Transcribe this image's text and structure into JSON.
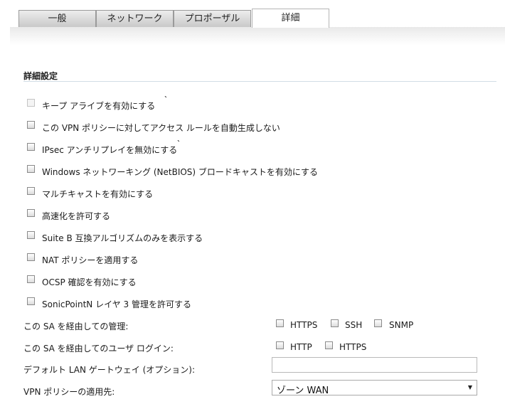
{
  "tabs": [
    {
      "label": "一般"
    },
    {
      "label": "ネットワーク"
    },
    {
      "label": "プロポーザル"
    },
    {
      "label": "詳細"
    }
  ],
  "section": {
    "title": "詳細設定"
  },
  "checkboxes": [
    {
      "label": "キープ アライブを有効にする",
      "checked": false,
      "disabled": true
    },
    {
      "label": "この VPN ポリシーに対してアクセス ルールを自動生成しない",
      "checked": false
    },
    {
      "label": "IPsec アンチリプレイを無効にする",
      "checked": false
    },
    {
      "label": "Windows ネットワーキング (NetBIOS) ブロードキャストを有効にする",
      "checked": false
    },
    {
      "label": "マルチキャストを有効にする",
      "checked": false
    },
    {
      "label": "高速化を許可する",
      "checked": false
    },
    {
      "label": "Suite B 互換アルゴリズムのみを表示する",
      "checked": false
    },
    {
      "label": "NAT ポリシーを適用する",
      "checked": false
    },
    {
      "label": "OCSP 確認を有効にする",
      "checked": false
    },
    {
      "label": "SonicPointN レイヤ 3 管理を許可する",
      "checked": false
    }
  ],
  "management": {
    "label": "この SA を経由しての管理:",
    "options": [
      {
        "label": "HTTPS",
        "checked": false
      },
      {
        "label": "SSH",
        "checked": false
      },
      {
        "label": "SNMP",
        "checked": false
      }
    ]
  },
  "user_login": {
    "label": "この SA を経由してのユーザ ログイン:",
    "options": [
      {
        "label": "HTTP",
        "checked": false
      },
      {
        "label": "HTTPS",
        "checked": false
      }
    ]
  },
  "default_gateway": {
    "label": "デフォルト LAN ゲートウェイ (オプション):",
    "value": ""
  },
  "apply_to": {
    "label": "VPN ポリシーの適用先:",
    "selected": "ゾーン WAN"
  },
  "icons": {
    "dropdown": "chevron-down-icon",
    "tick": "tick-mark"
  }
}
